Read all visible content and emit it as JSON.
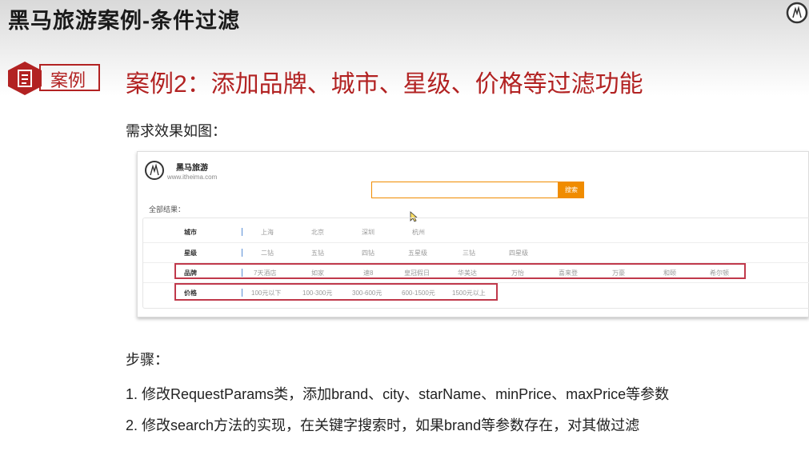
{
  "slide": {
    "title": "黑马旅游案例-条件过滤",
    "case_tag": "案例",
    "headline": "案例2：添加品牌、城市、星级、价格等过滤功能",
    "requirement_intro": "需求效果如图：",
    "steps_title": "步骤：",
    "steps": [
      "1.  修改RequestParams类，添加brand、city、starName、minPrice、maxPrice等参数",
      "2.  修改search方法的实现，在关键字搜索时，如果brand等参数存在，对其做过滤"
    ],
    "accent_color": "#b22222"
  },
  "mockup": {
    "brand": "黑马旅游",
    "url": "www.itheima.com",
    "search_placeholder": "",
    "search_button": "搜索",
    "all_results": "全部结果：",
    "accent_color": "#f08c00",
    "highlight_color": "#c0394b",
    "rows": [
      {
        "label": "城市",
        "items": [
          "上海",
          "北京",
          "深圳",
          "杭州"
        ]
      },
      {
        "label": "星级",
        "items": [
          "二钻",
          "五钻",
          "四钻",
          "五星级",
          "三钻",
          "四星级"
        ]
      },
      {
        "label": "品牌",
        "items": [
          "7天酒店",
          "如家",
          "速8",
          "皇冠假日",
          "华美达",
          "万怡",
          "喜来登",
          "万豪",
          "和颐",
          "希尔顿"
        ]
      },
      {
        "label": "价格",
        "items": [
          "100元以下",
          "100-300元",
          "300-600元",
          "600-1500元",
          "1500元以上"
        ]
      }
    ]
  }
}
